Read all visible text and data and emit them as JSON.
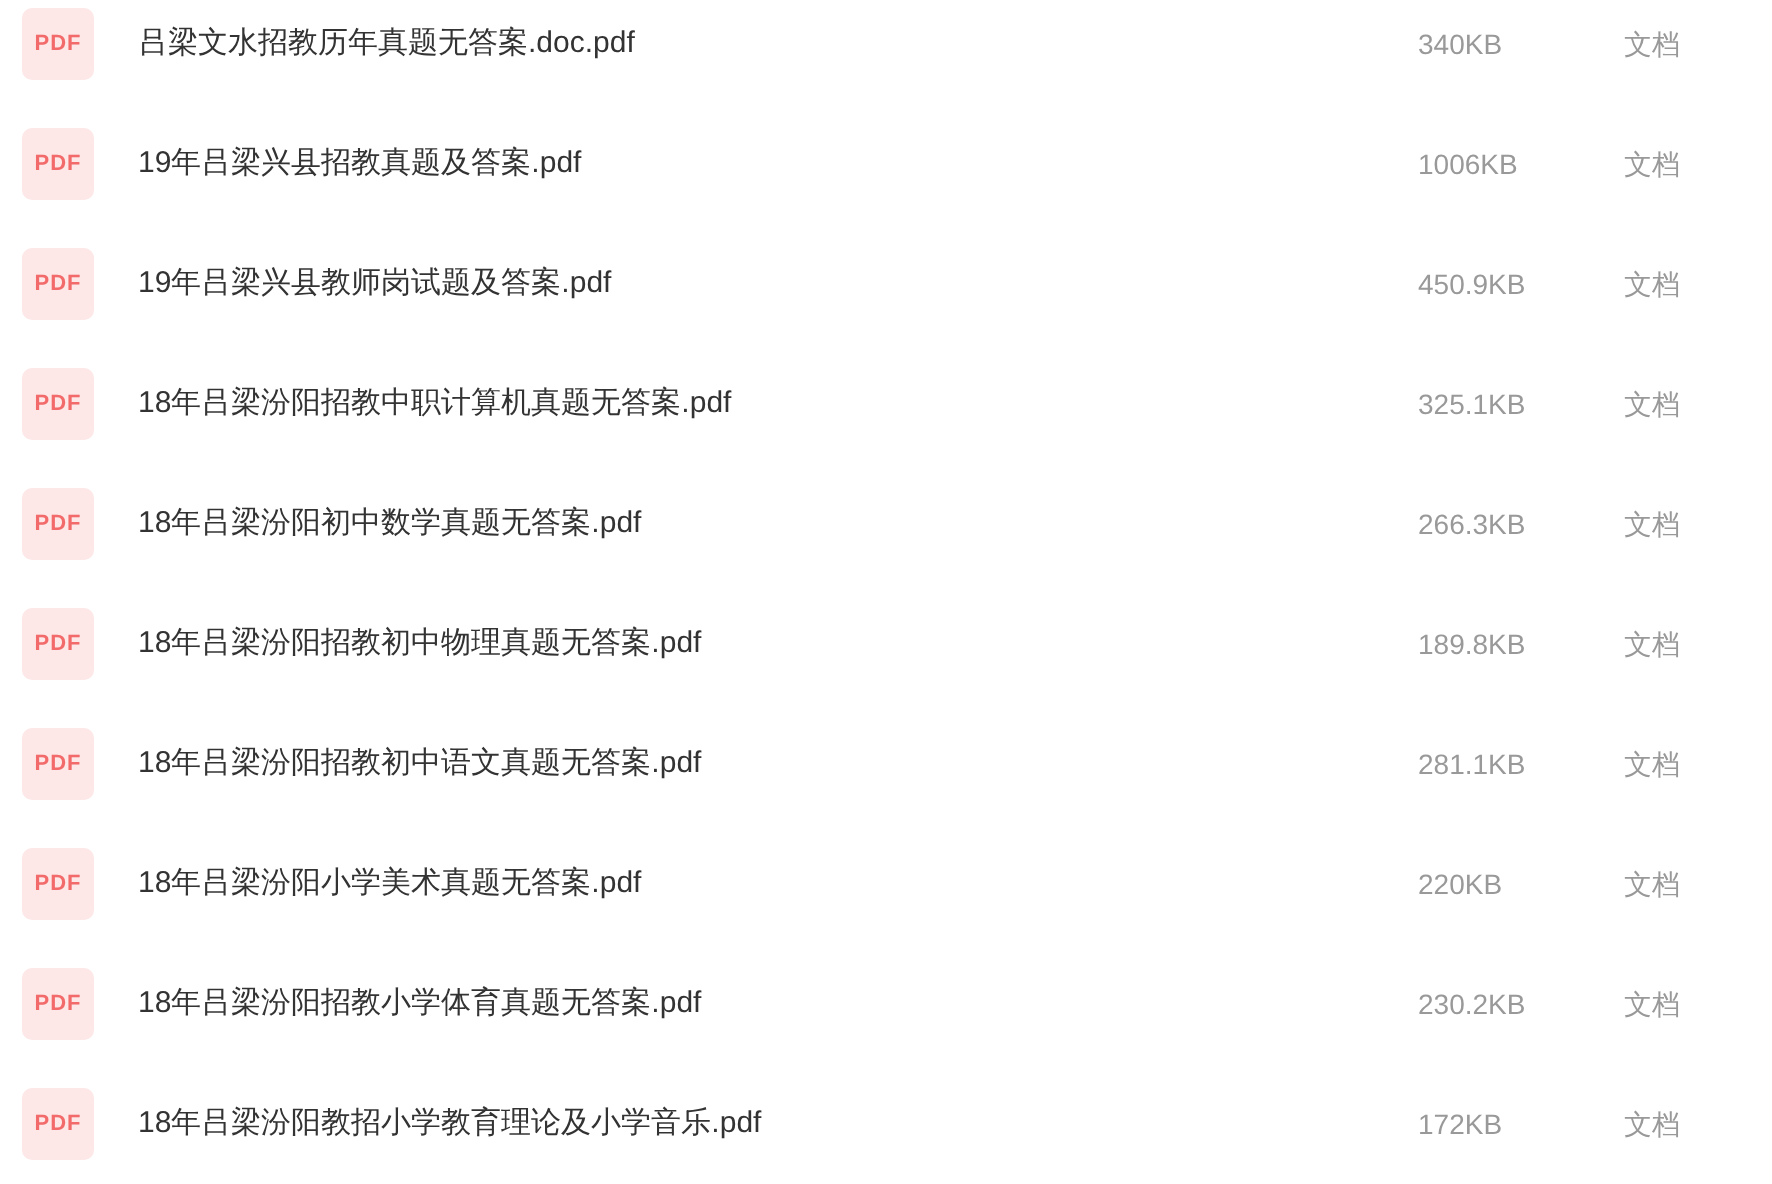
{
  "files": [
    {
      "badge": "PDF",
      "name": "吕梁文水招教历年真题无答案.doc.pdf",
      "size": "340KB",
      "type": "文档"
    },
    {
      "badge": "PDF",
      "name": "19年吕梁兴县招教真题及答案.pdf",
      "size": "1006KB",
      "type": "文档"
    },
    {
      "badge": "PDF",
      "name": "19年吕梁兴县教师岗试题及答案.pdf",
      "size": "450.9KB",
      "type": "文档"
    },
    {
      "badge": "PDF",
      "name": "18年吕梁汾阳招教中职计算机真题无答案.pdf",
      "size": "325.1KB",
      "type": "文档"
    },
    {
      "badge": "PDF",
      "name": "18年吕梁汾阳初中数学真题无答案.pdf",
      "size": "266.3KB",
      "type": "文档"
    },
    {
      "badge": "PDF",
      "name": "18年吕梁汾阳招教初中物理真题无答案.pdf",
      "size": "189.8KB",
      "type": "文档"
    },
    {
      "badge": "PDF",
      "name": "18年吕梁汾阳招教初中语文真题无答案.pdf",
      "size": "281.1KB",
      "type": "文档"
    },
    {
      "badge": "PDF",
      "name": "18年吕梁汾阳小学美术真题无答案.pdf",
      "size": "220KB",
      "type": "文档"
    },
    {
      "badge": "PDF",
      "name": "18年吕梁汾阳招教小学体育真题无答案.pdf",
      "size": "230.2KB",
      "type": "文档"
    },
    {
      "badge": "PDF",
      "name": "18年吕梁汾阳教招小学教育理论及小学音乐.pdf",
      "size": "172KB",
      "type": "文档"
    }
  ]
}
